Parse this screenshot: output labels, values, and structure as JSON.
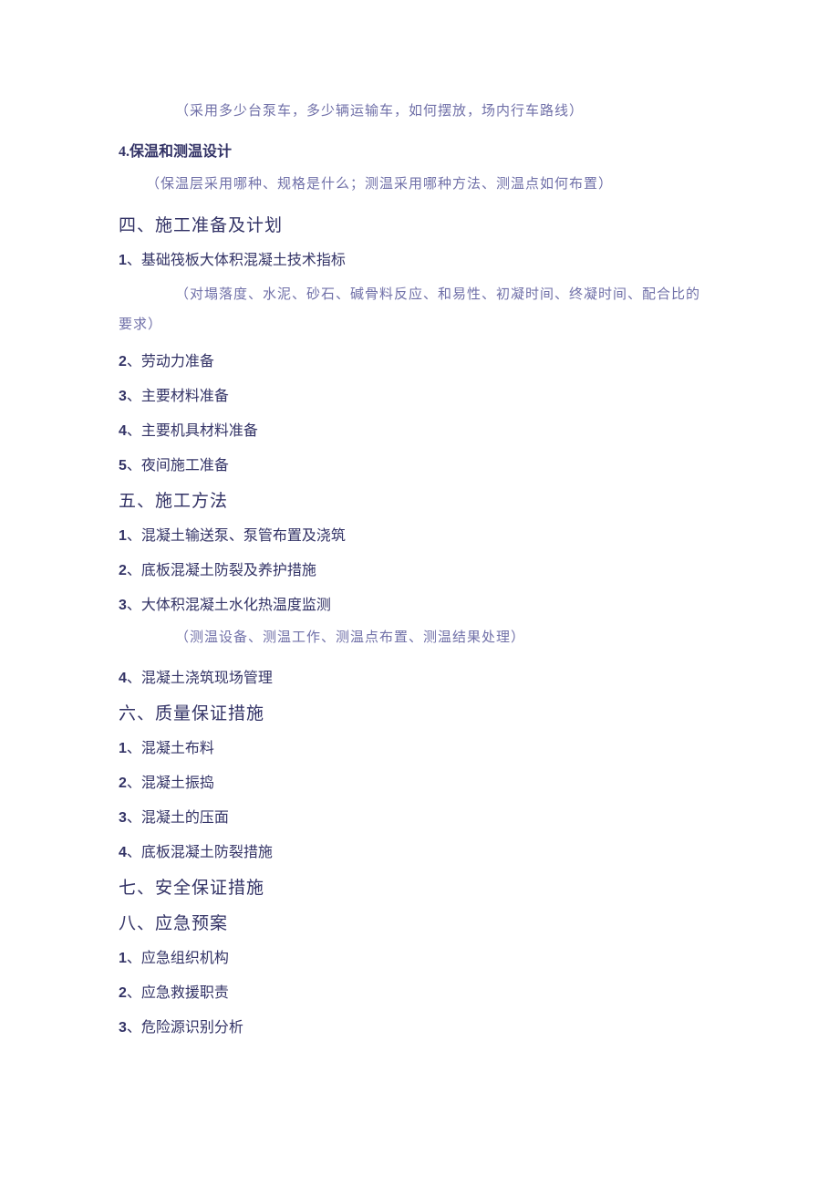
{
  "note1": "（采用多少台泵车，多少辆运输车，如何摆放，场内行车路线）",
  "s3_4": "4.保温和测温设计",
  "note2": "（保温层采用哪种、规格是什么；测温采用哪种方法、测温点如何布置）",
  "s4_h": "四、施工准备及计划",
  "s4_1": "、基础筏板大体积混凝土技术指标",
  "note3a": "（对塌落度、水泥、砂石、碱骨料反应、和易性、初凝时间、终凝时间、配合比的",
  "note3b": "要求）",
  "s4_2": "、劳动力准备",
  "s4_3": "、主要材料准备",
  "s4_4": "、主要机具材料准备",
  "s4_5": "、夜间施工准备",
  "s5_h": "五、施工方法",
  "s5_1": "、混凝土输送泵、泵管布置及浇筑",
  "s5_2": "、底板混凝土防裂及养护措施",
  "s5_3": "、大体积混凝土水化热温度监测",
  "note4": "（测温设备、测温工作、测温点布置、测温结果处理）",
  "s5_4": "、混凝土浇筑现场管理",
  "s6_h": "六、质量保证措施",
  "s6_1": "、混凝土布料",
  "s6_2": "、混凝土振捣",
  "s6_3": "、混凝土的压面",
  "s6_4": "、底板混凝土防裂措施",
  "s7_h": "七、安全保证措施",
  "s8_h": "八、应急预案",
  "s8_1": "、应急组织机构",
  "s8_2": "、应急救援职责",
  "s8_3": "、危险源识别分析"
}
